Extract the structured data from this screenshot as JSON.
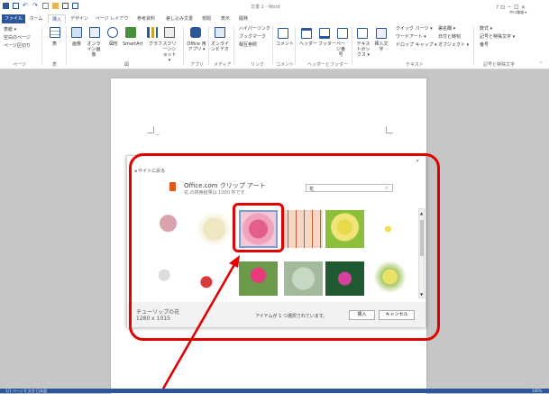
{
  "window": {
    "title": "文書 1 - Word",
    "controls": "?  ⊡ －  ロ  ✕",
    "user": "中川雅雄 ▾"
  },
  "tabs": [
    "ファイル",
    "ホーム",
    "挿入",
    "デザイン",
    "ページ レイアウト",
    "参考資料",
    "差し込み文書",
    "校閲",
    "表示",
    "開発"
  ],
  "ribbon": {
    "pages": {
      "items": [
        "表紙 ▾",
        "空白のページ",
        "ページ区切り"
      ],
      "label": "ページ"
    },
    "table": {
      "items": [
        "表"
      ],
      "label": "表"
    },
    "illustrations": {
      "items": [
        "画像",
        "オンライン画像",
        "図形",
        "SmartArt",
        "グラフ",
        "スクリーンショット ▾"
      ],
      "label": "図"
    },
    "apps": {
      "items": [
        "Office 用アプリ ▾"
      ],
      "label": "アプリ"
    },
    "media": {
      "items": [
        "オンラインビデオ"
      ],
      "label": "メディア"
    },
    "links": {
      "items": [
        "ハイパーリンク",
        "ブックマーク",
        "相互参照"
      ],
      "label": "リンク"
    },
    "comments": {
      "items": [
        "コメント"
      ],
      "label": "コメント"
    },
    "header_footer": {
      "items": [
        "ヘッダー",
        "フッター",
        "ページ番号"
      ],
      "label": "ヘッダーとフッター"
    },
    "text": {
      "items": [
        "テキストボックス ▾",
        "挿入文字",
        "クイック パーツ ▾",
        "ワードアート ▾",
        "ドロップ キャップ ▾",
        "署名欄 ▾",
        "日付と時刻",
        "オブジェクト ▾"
      ],
      "label": "テキスト"
    },
    "symbols": {
      "items": [
        "数式 ▾",
        "記号と特殊文字 ▾",
        "番号"
      ],
      "label": "記号と特殊文字"
    }
  },
  "dialog": {
    "back_link": "◂ サイトに戻る",
    "source_name": "Office.com クリップ アート",
    "result_summary": "花 の検索結果は 1000 件です",
    "search_value": "花",
    "selected_name": "チューリップの花",
    "selected_size": "1280 x 1015",
    "status_text": "アイテムが 1 つ選択されています。",
    "insert_button": "挿入",
    "cancel_button": "キャンセル",
    "close_glyph": "✕"
  },
  "status": {
    "left": "1/1 ページ  0 文字  日本語",
    "zoom": "100%"
  },
  "colors": {
    "word_blue": "#2b579a",
    "highlight": "#e00000"
  }
}
